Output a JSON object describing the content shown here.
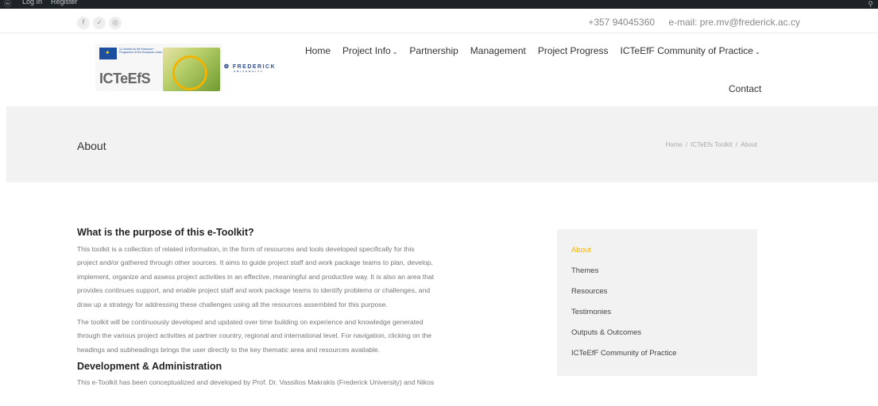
{
  "adminbar": {
    "wp_icon": "wordpress-icon",
    "login": "Log In",
    "register": "Register",
    "search_icon": "search-icon"
  },
  "topbar": {
    "social": [
      {
        "icon": "facebook-icon",
        "glyph": "f"
      },
      {
        "icon": "twitter-icon",
        "glyph": "✓"
      },
      {
        "icon": "instagram-icon",
        "glyph": "◎"
      }
    ],
    "phone": "+357 94045360",
    "email": "e-mail: pre.mv@frederick.ac.cy"
  },
  "logo": {
    "eu_text": "Co-funded by the Erasmus+ Programme of the European Union",
    "brand": "ICTeEfS",
    "partner": "FREDERICK",
    "partner_sub": "UNIVERSITY"
  },
  "nav": {
    "items": [
      "Home",
      "Project Info",
      "Partnership",
      "Management",
      "Project Progress",
      "ICTeEfF Community of Practice"
    ],
    "dropdown_icon": "chevron-down-icon",
    "contact": "Contact"
  },
  "titlebar": {
    "title": "About",
    "breadcrumb": [
      "Home",
      "ICTeEfs Toolkit",
      "About"
    ],
    "separator": "/"
  },
  "content": {
    "heading1": "What is the purpose of this e-Toolkit?",
    "para1_lines": [
      "This toolkit is a collection of related information, in the form of resources and tools developed specifically for this",
      "project and/or gathered through other sources. It aims to guide project staff and work package teams to plan, develop,",
      "implement, organize and assess project activities in an effective, meaningful and productive way. It is also an area that",
      "provides continues support, and enable project staff and work package teams to identify problems or challenges, and",
      "draw up a strategy for addressing these challenges using all the resources assembled for this purpose."
    ],
    "para2_lines": [
      "The toolkit will be continuously developed and updated over time building on experience and knowledge generated",
      "through the various project activities at partner country, regional and international level. For navigation, clicking on the",
      "headings and subheadings brings the user directly to the key thematic area and resources available."
    ],
    "heading2": "Development & Administration",
    "para3_lines": [
      "This e-Toolkit has been conceptualized and developed by Prof. Dr. Vassilios Makrakis (Frederick University) and Nikos"
    ]
  },
  "sidebar": {
    "links": [
      "About",
      "Themes",
      "Resources",
      "Testimonies",
      "Outputs & Outcomes",
      "ICTeEfF Community of Practice"
    ],
    "active_color": "#f5b400"
  }
}
